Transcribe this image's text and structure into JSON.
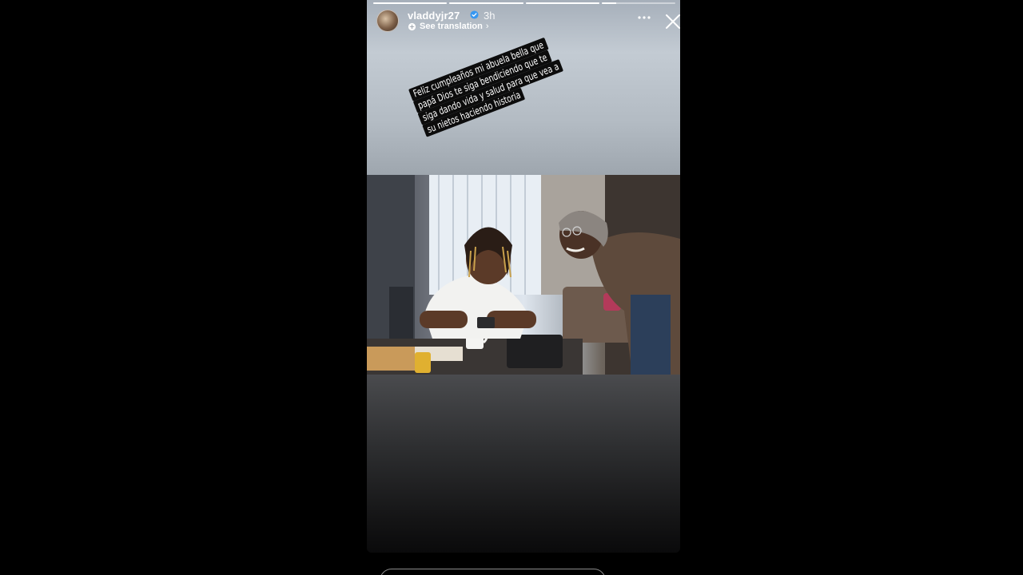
{
  "story": {
    "username": "vladdyjr27",
    "time_ago": "3h",
    "see_translation": "See translation",
    "verified": true,
    "progress_segments": [
      1,
      1,
      1,
      0.2
    ],
    "caption_lines": [
      "Feliz cumpleaños mi abuela bella que",
      "papá Dios te siga bendiciendo que te",
      "siga dando vida y salud para que vea a",
      "su nietos haciendo historia"
    ]
  },
  "icons": {
    "avatar": "profile-avatar",
    "verified": "verified-badge-icon",
    "translate": "translate-icon",
    "more": "more-options-icon",
    "close": "close-icon"
  },
  "colors": {
    "background": "#000000",
    "text": "#ffffff",
    "caption_bg": "#0c0c0c",
    "verified_blue": "#3897f0"
  }
}
